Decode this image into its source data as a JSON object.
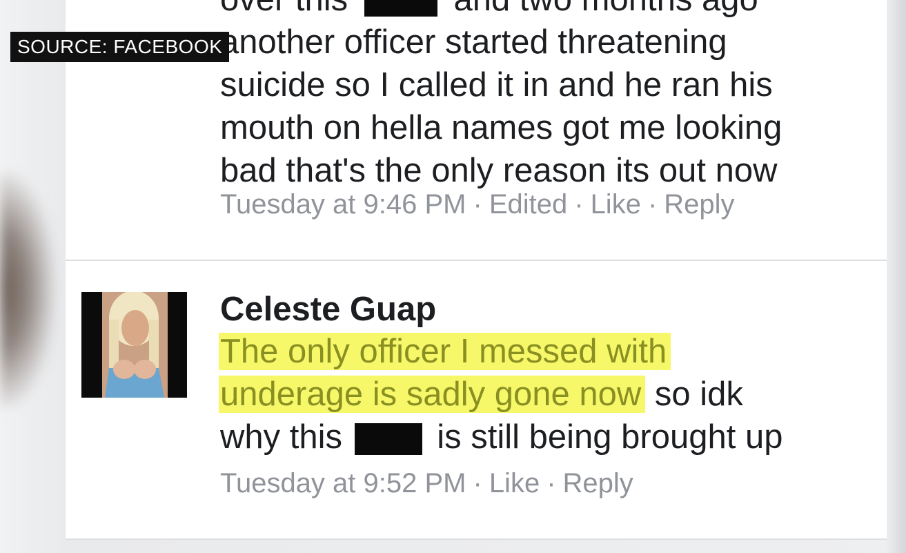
{
  "overlay": {
    "source_label": "SOURCE: FACEBOOK"
  },
  "comment_top": {
    "partial_line_start": "over this",
    "partial_line_end": "and two months ago",
    "lines": [
      "another officer started threatening",
      "suicide so I called it in and he ran his",
      "mouth on hella names got me looking",
      "bad that's the only reason its out now"
    ],
    "meta": {
      "time": "Tuesday at 9:46 PM",
      "edited": "Edited",
      "like": "Like",
      "reply": "Reply"
    }
  },
  "comment_bottom": {
    "author": "Celeste Guap",
    "line1_highlight": "The only officer I messed with",
    "line2_highlight": "underage is sadly gone now",
    "line2_rest": "so idk",
    "line3_start": "why this",
    "line3_end": "is still being brought up",
    "meta": {
      "time": "Tuesday at 9:52 PM",
      "like": "Like",
      "reply": "Reply"
    }
  },
  "colors": {
    "highlight": "#f6f86a",
    "highlight_text": "#8a8f21",
    "meta_text": "#909399",
    "body_text": "#1c1e21"
  },
  "icons": {
    "dot_separator": "·"
  }
}
